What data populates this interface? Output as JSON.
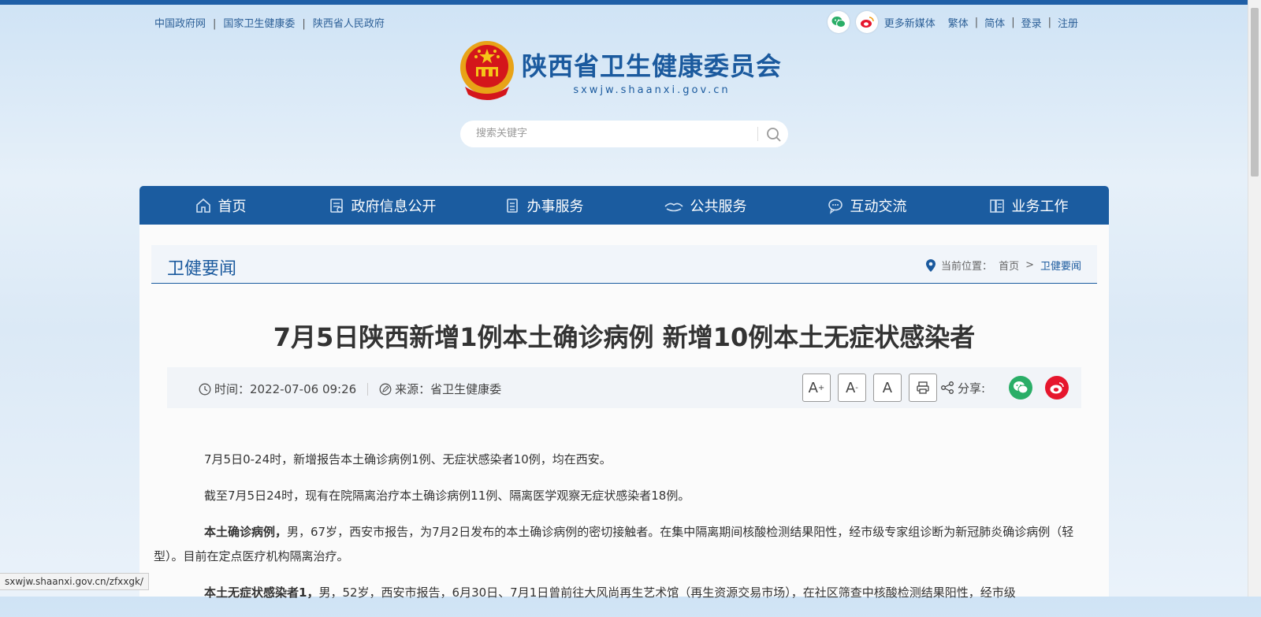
{
  "top_links": [
    "中国政府网",
    "国家卫生健康委",
    "陕西省人民政府"
  ],
  "top_right": {
    "media_label": "更多新媒体",
    "links": [
      "繁体",
      "简体",
      "登录",
      "注册"
    ]
  },
  "logo": {
    "title": "陕西省卫生健康委员会",
    "url": "sxwjw.shaanxi.gov.cn"
  },
  "search": {
    "placeholder": "搜索关键字"
  },
  "nav": [
    {
      "label": "首页",
      "icon": "home-icon"
    },
    {
      "label": "政府信息公开",
      "icon": "document-icon"
    },
    {
      "label": "办事服务",
      "icon": "clipboard-icon"
    },
    {
      "label": "公共服务",
      "icon": "handshake-icon"
    },
    {
      "label": "互动交流",
      "icon": "chat-icon"
    },
    {
      "label": "业务工作",
      "icon": "books-icon"
    }
  ],
  "section": {
    "title": "卫健要闻",
    "location_label": "当前位置：",
    "crumb_home": "首页",
    "crumb_sep": ">",
    "crumb_current": "卫健要闻"
  },
  "article": {
    "title": "7月5日陕西新增1例本土确诊病例 新增10例本土无症状感染者",
    "time": "时间：2022-07-06 09:26",
    "source": "来源：省卫生健康委",
    "share_label": "分享:",
    "font_buttons": [
      "A",
      "A",
      "A"
    ],
    "paragraphs": [
      "7月5日0-24时，新增报告本土确诊病例1例、无症状感染者10例，均在西安。",
      "截至7月5日24时，现有在院隔离治疗本土确诊病例11例、隔离医学观察无症状感染者18例。"
    ],
    "p3_bold": "本土确诊病例，",
    "p3_text": "男，67岁，西安市报告，为7月2日发布的本土确诊病例的密切接触者。在集中隔离期间核酸检测结果阳性，经市级专家组诊断为新冠肺炎确诊病例（轻型）。目前在定点医疗机构隔离治疗。",
    "p4_bold": "本土无症状感染者1，",
    "p4_text": "男，52岁，西安市报告，6月30日、7月1日曾前往大风尚再生艺术馆（再生资源交易市场），在社区筛查中核酸检测结果阳性，经市级"
  },
  "status_url": "sxwjw.shaanxi.gov.cn/zfxxgk/",
  "colors": {
    "brand": "#1b5ca0",
    "wechat": "#2aae67",
    "weibo": "#e6162d"
  }
}
